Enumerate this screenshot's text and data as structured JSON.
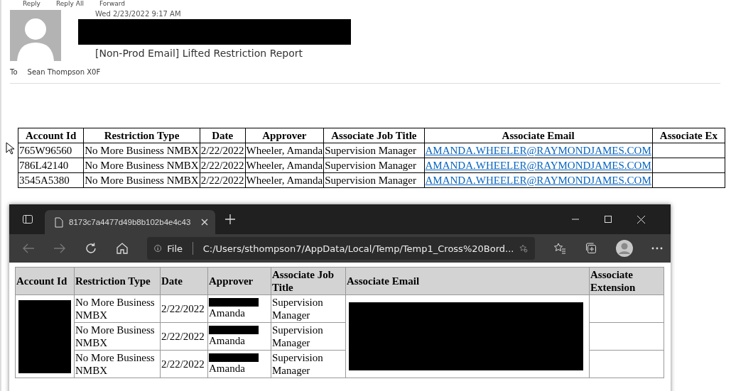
{
  "email": {
    "actions": [
      "Reply",
      "Reply All",
      "Forward"
    ],
    "timestamp": "Wed 2/23/2022 9:17 AM",
    "subject": "[Non-Prod Email] Lifted Restriction Report",
    "to_label": "To",
    "recipient": "Sean Thompson X0F"
  },
  "report_table": {
    "columns": [
      "Account Id",
      "Restriction Type",
      "Date",
      "Approver",
      "Associate Job Title",
      "Associate Email",
      "Associate Ex"
    ],
    "rows": [
      {
        "account_id": "765W96560",
        "restriction_type": "No More Business NMBX",
        "date": "2/22/2022",
        "approver": "Wheeler, Amanda",
        "job_title": "Supervision Manager",
        "email": "AMANDA.WHEELER@RAYMONDJAMES.COM"
      },
      {
        "account_id": "786L42140",
        "restriction_type": "No More Business NMBX",
        "date": "2/22/2022",
        "approver": "Wheeler, Amanda",
        "job_title": "Supervision Manager",
        "email": "AMANDA.WHEELER@RAYMONDJAMES.COM"
      },
      {
        "account_id": "3545A5380",
        "restriction_type": "No More Business NMBX",
        "date": "2/22/2022",
        "approver": "Wheeler, Amanda",
        "job_title": "Supervision Manager",
        "email": "AMANDA.WHEELER@RAYMONDJAMES.COM"
      }
    ]
  },
  "browser": {
    "tab_title": "8173c7a4477d49b8b102b4e4c43",
    "address_prefix": "File",
    "url": "C:/Users/sthompson7/AppData/Local/Temp/Temp1_Cross%20Bord...",
    "table": {
      "columns": [
        "Account Id",
        "Restriction Type",
        "Date",
        "Approver",
        "Associate Job Title",
        "Associate Email",
        "Associate Extension"
      ],
      "rows": [
        {
          "restriction_type": "No More Business NMBX",
          "date": "2/22/2022",
          "approver": "Amanda",
          "job_title": "Supervision Manager"
        },
        {
          "restriction_type": "No More Business NMBX",
          "date": "2/22/2022",
          "approver": "Amanda",
          "job_title": "Supervision Manager"
        },
        {
          "restriction_type": "No More Business NMBX",
          "date": "2/22/2022",
          "approver": "Amanda",
          "job_title": "Supervision Manager"
        }
      ]
    }
  }
}
